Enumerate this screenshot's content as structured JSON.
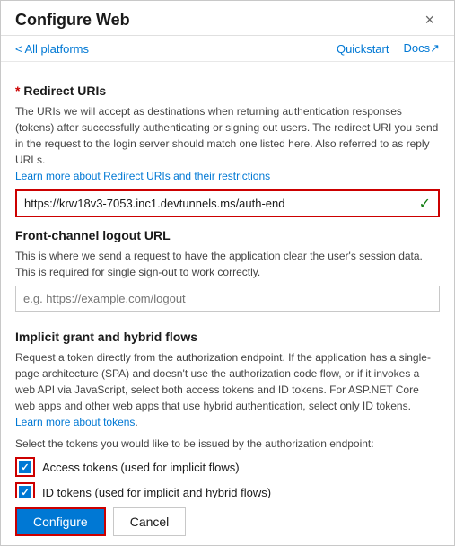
{
  "dialog": {
    "title": "Configure Web",
    "close_label": "×"
  },
  "nav": {
    "back_label": "< All platforms",
    "quickstart_label": "Quickstart",
    "docs_label": "Docs↗"
  },
  "redirect_uris": {
    "section_title": "* Redirect URIs",
    "description": "The URIs we will accept as destinations when returning authentication responses (tokens) after successfully authenticating or signing out users. The redirect URI you send in the request to the login server should match one listed here. Also referred to as reply URLs.",
    "link_text": "Learn more about Redirect URIs and their restrictions",
    "input_value": "https://krw18v3-7053.inc1.devtunnels.ms/auth-end",
    "checkmark": "✓"
  },
  "logout": {
    "section_title": "Front-channel logout URL",
    "description": "This is where we send a request to have the application clear the user's session data. This is required for single sign-out to work correctly.",
    "placeholder": "e.g. https://example.com/logout"
  },
  "implicit": {
    "section_title": "Implicit grant and hybrid flows",
    "description": "Request a token directly from the authorization endpoint. If the application has a single-page architecture (SPA) and doesn't use the authorization code flow, or if it invokes a web API via JavaScript, select both access tokens and ID tokens. For ASP.NET Core web apps and other web apps that use hybrid authentication, select only ID tokens.",
    "link_text": "Learn more about tokens",
    "select_label": "Select the tokens you would like to be issued by the authorization endpoint:",
    "checkboxes": [
      {
        "label": "Access tokens (used for implicit flows)",
        "checked": true
      },
      {
        "label": "ID tokens (used for implicit and hybrid flows)",
        "checked": true
      }
    ]
  },
  "footer": {
    "configure_label": "Configure",
    "cancel_label": "Cancel"
  }
}
